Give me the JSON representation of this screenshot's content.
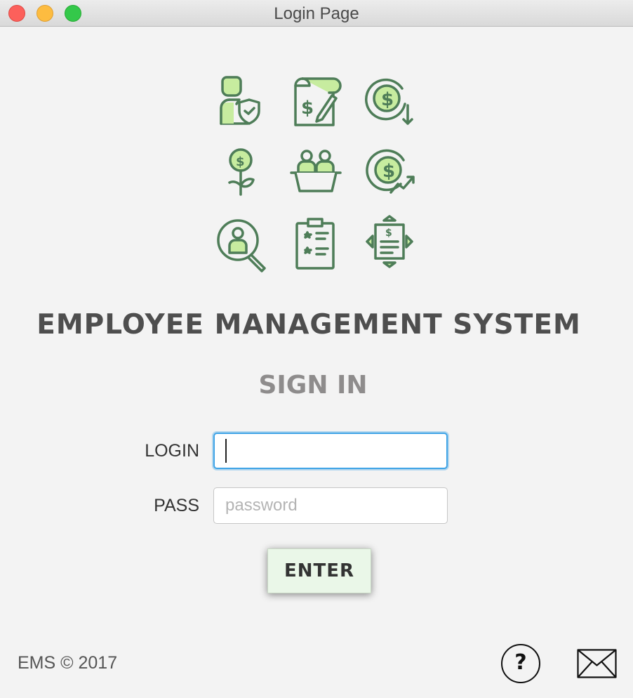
{
  "window": {
    "title": "Login Page"
  },
  "icons": [
    "employee-insurance-icon",
    "salary-contract-icon",
    "money-decrease-icon",
    "money-plant-icon",
    "team-basket-icon",
    "money-growth-icon",
    "employee-search-icon",
    "performance-checklist-icon",
    "payslip-transfer-icon"
  ],
  "header": {
    "app_title": "EMPLOYEE MANAGEMENT SYSTEM",
    "subtitle": "SIGN IN"
  },
  "form": {
    "login_label": "LOGIN",
    "login_value": "",
    "pass_label": "PASS",
    "pass_placeholder": "password",
    "enter_label": "ENTER"
  },
  "footer": {
    "copyright": "EMS © 2017",
    "help_label": "?"
  },
  "colors": {
    "icon_stroke": "#4e7d58",
    "icon_fill": "#c7ec9f",
    "focus_ring": "#3ea3e6",
    "button_bg": "#eaf7e8"
  }
}
